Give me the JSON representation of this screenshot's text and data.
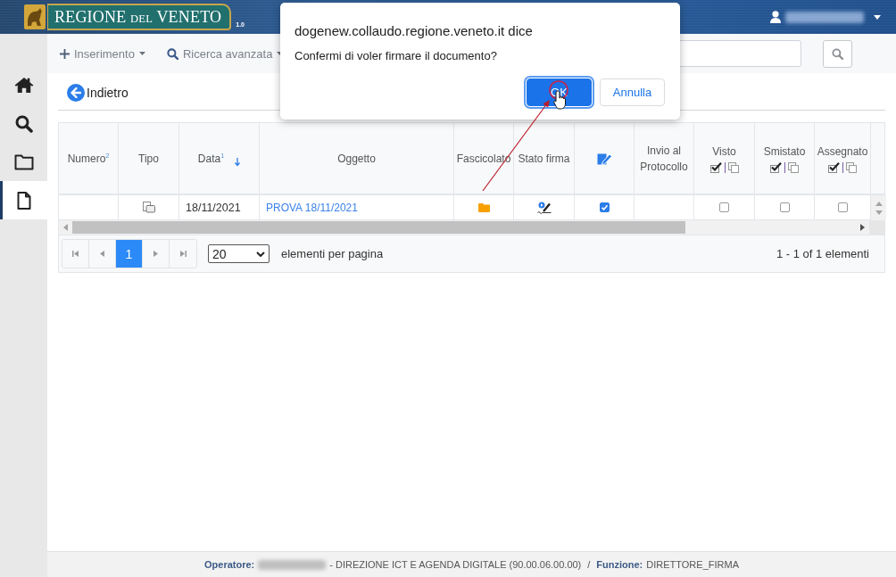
{
  "header": {
    "logo": {
      "words": [
        {
          "text": "REGIONE",
          "small": false
        },
        {
          "text": "DEL",
          "small": true
        },
        {
          "text": "VENETO",
          "small": false
        }
      ],
      "version": "1.0"
    }
  },
  "sidebar": {
    "items": [
      {
        "kind": "home",
        "selected": false
      },
      {
        "kind": "search",
        "selected": false
      },
      {
        "kind": "folder",
        "selected": false
      },
      {
        "kind": "document",
        "selected": true
      }
    ]
  },
  "toolbar": {
    "menus": [
      {
        "kind": "add",
        "label": "Inserimento"
      },
      {
        "kind": "search",
        "label": "Ricerca avanzata"
      }
    ]
  },
  "back_link": {
    "label": "Indietro"
  },
  "table": {
    "columns": [
      {
        "kind": "text",
        "label": "Numero$^{2}$",
        "sorted": false
      },
      {
        "kind": "text",
        "label": "Tipo",
        "sorted": false
      },
      {
        "kind": "text",
        "label": "Data$^{1}$",
        "sorted": true
      },
      {
        "kind": "text",
        "label": "Oggetto",
        "sorted": false
      },
      {
        "kind": "text",
        "label": "Fascicolato",
        "sorted": false
      },
      {
        "kind": "text",
        "label": "Stato firma",
        "sorted": false
      },
      {
        "kind": "icon",
        "sorted": false
      },
      {
        "kind": "text",
        "label": "Invio al Protocollo",
        "sorted": false
      },
      {
        "kind": "bulk",
        "label": "Visto",
        "sorted": false
      },
      {
        "kind": "bulk",
        "label": "Smistato",
        "sorted": false
      },
      {
        "kind": "bulk",
        "label": "Assegnato",
        "sorted": false
      }
    ],
    "rows": [
      {
        "cells": [
          {
            "kind": "empty"
          },
          {
            "kind": "type-icon"
          },
          {
            "kind": "text",
            "text": "18/11/2021"
          },
          {
            "kind": "link",
            "text": "PROVA 18/11/2021"
          },
          {
            "kind": "folder"
          },
          {
            "kind": "signature"
          },
          {
            "kind": "checkbox",
            "checked": true
          },
          {
            "kind": "empty"
          },
          {
            "kind": "checkbox",
            "checked": false
          },
          {
            "kind": "checkbox",
            "checked": false
          },
          {
            "kind": "checkbox",
            "checked": false
          }
        ]
      }
    ]
  },
  "pager": {
    "nav_before": [
      {
        "kind": "first",
        "disabled": true
      },
      {
        "kind": "prev",
        "disabled": true
      }
    ],
    "pages": [
      {
        "label": "1",
        "selected": true
      }
    ],
    "nav_after": [
      {
        "kind": "next",
        "disabled": true
      },
      {
        "kind": "last",
        "disabled": true
      }
    ],
    "page_size": "20",
    "page_size_label": "elementi per pagina",
    "summary": "1 - 1 of 1 elementi"
  },
  "dialog": {
    "origin": "dogenew.collaudo.regione.veneto.it dice",
    "message": "Confermi di voler firmare il documento?",
    "buttons": [
      {
        "kind": "primary",
        "label": "OK"
      },
      {
        "kind": "secondary",
        "label": "Annulla"
      }
    ]
  },
  "footer": {
    "operator_label": "Operatore:",
    "department": "- DIREZIONE ICT E AGENDA DIGITALE (90.00.06.00.00)",
    "separator": "/",
    "function_label": "Funzione:",
    "function_value": "DIRETTORE_FIRMA"
  }
}
